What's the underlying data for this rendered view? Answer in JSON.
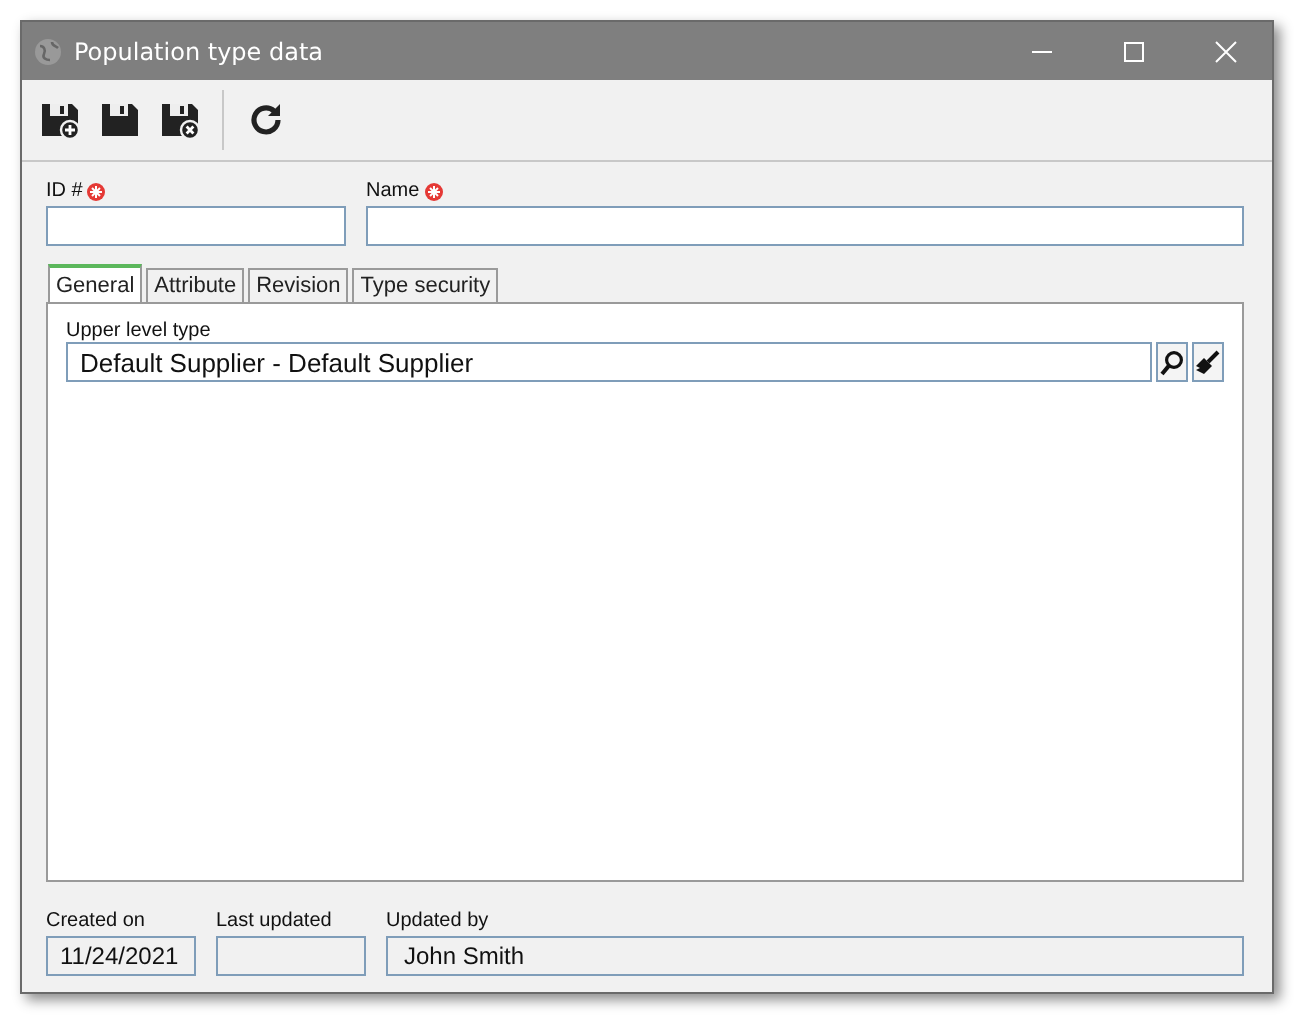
{
  "window": {
    "title": "Population type data"
  },
  "toolbar": [
    {
      "kind": "save-new"
    },
    {
      "kind": "save"
    },
    {
      "kind": "save-close"
    },
    {
      "kind": "separator"
    },
    {
      "kind": "refresh"
    }
  ],
  "fields": [
    {
      "label": "ID #",
      "required": true
    },
    {
      "label": "Name",
      "required": true
    }
  ],
  "tabs": [
    {
      "label": "General",
      "selected": true
    },
    {
      "label": "Attribute",
      "selected": false
    },
    {
      "label": "Revision",
      "selected": false
    },
    {
      "label": "Type security",
      "selected": false
    }
  ],
  "general": {
    "label": "Upper level type",
    "value": "Default Supplier - Default Supplier"
  },
  "footer": [
    {
      "label": "Created on",
      "value": "11/24/2021"
    },
    {
      "label": "Last updated"
    },
    {
      "label": "Updated by",
      "value": "John Smith"
    }
  ]
}
